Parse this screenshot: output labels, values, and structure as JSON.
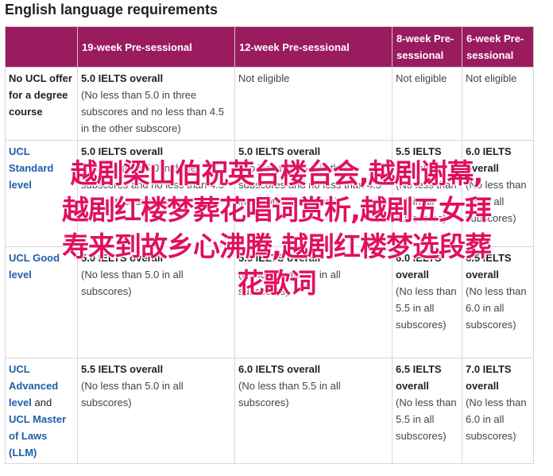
{
  "page": {
    "title": "English language requirements"
  },
  "table": {
    "headers": [
      "",
      "19-week Pre-sessional",
      "12-week Pre-sessional",
      "8-week Pre-sessional",
      "6-week Pre-sessional"
    ],
    "rows": [
      {
        "label": [
          "No UCL offer for a degree course"
        ],
        "cells": [
          {
            "score": "5.0 IELTS overall",
            "note": "(No less than 5.0 in three subscores and no less than 4.5 in the other subscore)"
          },
          {
            "score": "",
            "note": "Not eligible"
          },
          {
            "score": "",
            "note": "Not eligible"
          },
          {
            "score": "",
            "note": "Not eligible"
          }
        ]
      },
      {
        "label": [
          "UCL Standard level"
        ],
        "cells": [
          {
            "score": "5.0 IELTS overall",
            "note": "(No less than 5.0 in three subscores and no less than 4.5 in the other subscore)"
          },
          {
            "score": "5.0 IELTS overall",
            "note": "(No less than 5.0 in three subscores and no less than 4.5 in the other subscore)"
          },
          {
            "score": "5.5 IELTS overall",
            "note": "(No less than 5.0 in all subscores)"
          },
          {
            "score": "6.0 IELTS overall",
            "note": "(No less than 5.5 in all subscores)"
          }
        ]
      },
      {
        "label": [
          "UCL Good level"
        ],
        "cells": [
          {
            "score": "5.0 IELTS overall",
            "note": "(No less than 5.0 in all subscores)"
          },
          {
            "score": "5.5 IELTS overall",
            "note": "(No less than 5.0 in all subscores)"
          },
          {
            "score": "6.0 IELTS overall",
            "note": "(No less than 5.5 in all subscores)"
          },
          {
            "score": "6.5 IELTS overall",
            "note": "(No less than 6.0 in all subscores)"
          }
        ]
      },
      {
        "label": [
          "UCL Advanced level",
          "and",
          "UCL Master of Laws (LLM)"
        ],
        "cells": [
          {
            "score": "5.5 IELTS overall",
            "note": "(No less than 5.0 in all subscores)"
          },
          {
            "score": "6.0 IELTS overall",
            "note": "(No less than 5.5 in all subscores)"
          },
          {
            "score": "6.5 IELTS overall",
            "note": "(No less than 5.5 in all subscores)"
          },
          {
            "score": "7.0 IELTS overall",
            "note": "(No less than 6.0 in all subscores)"
          }
        ]
      }
    ]
  },
  "overlay": {
    "lines": [
      "越剧梁山伯祝英台楼台会,越剧谢幕,",
      "越剧红楼梦葬花唱词赏析,越剧五女拜",
      "寿来到故乡心沸腾,越剧红楼梦选段葬",
      "花歌词"
    ]
  },
  "colors": {
    "header_bg": "#9b1b5f",
    "link": "#1f5ea8",
    "overlay_text": "#e0105f"
  }
}
